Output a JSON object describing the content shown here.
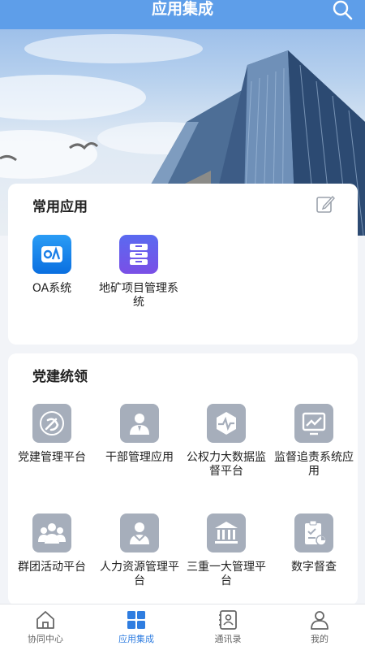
{
  "header": {
    "title": "应用集成"
  },
  "common_apps": {
    "title": "常用应用",
    "items": [
      {
        "label": "OA系统",
        "icon": "oa-icon"
      },
      {
        "label": "地矿项目管理系统",
        "icon": "project-management-icon"
      }
    ]
  },
  "party_apps": {
    "title": "党建统领",
    "items": [
      {
        "label": "党建管理平台",
        "icon": "party-emblem-icon"
      },
      {
        "label": "干部管理应用",
        "icon": "cadre-person-icon"
      },
      {
        "label": "公权力大数据监督平台",
        "icon": "monitor-pulse-icon"
      },
      {
        "label": "监督追责系统应用",
        "icon": "screen-chart-icon"
      },
      {
        "label": "群团活动平台",
        "icon": "group-people-icon"
      },
      {
        "label": "人力资源管理平台",
        "icon": "hr-person-icon"
      },
      {
        "label": "三重一大管理平台",
        "icon": "building-icon"
      },
      {
        "label": "数字督查",
        "icon": "clipboard-check-icon"
      }
    ]
  },
  "tabbar": {
    "tabs": [
      {
        "label": "协同中心",
        "icon": "home-icon",
        "active": false
      },
      {
        "label": "应用集成",
        "icon": "grid-icon",
        "active": true
      },
      {
        "label": "通讯录",
        "icon": "contacts-icon",
        "active": false
      },
      {
        "label": "我的",
        "icon": "user-icon",
        "active": false
      }
    ]
  },
  "colors": {
    "header_bg": "#5e9ee9",
    "active_tab": "#2f7de0",
    "page_bg": "#f2f4f8",
    "icon_grey": "#a6aebb"
  }
}
